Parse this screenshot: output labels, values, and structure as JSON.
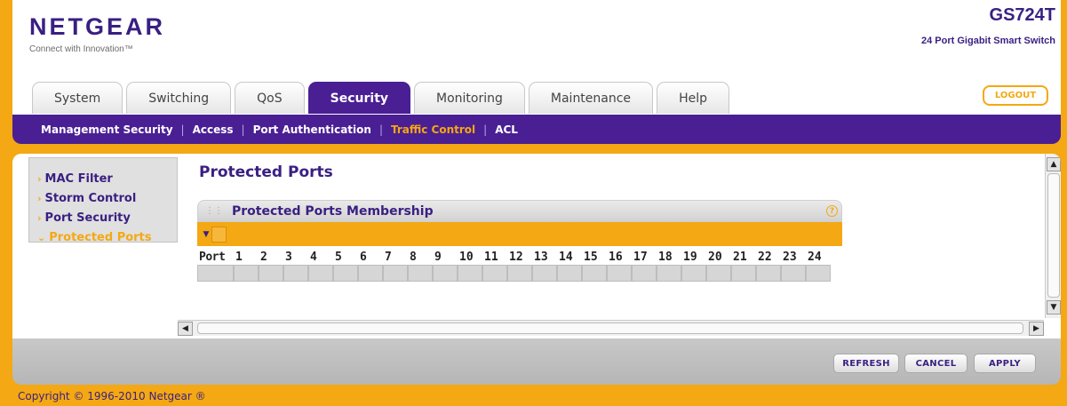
{
  "brand": {
    "name": "NETGEAR",
    "tagline": "Connect with Innovation™",
    "model": "GS724T",
    "model_desc": "24 Port Gigabit Smart Switch"
  },
  "tabs": [
    {
      "label": "System",
      "active": false
    },
    {
      "label": "Switching",
      "active": false
    },
    {
      "label": "QoS",
      "active": false
    },
    {
      "label": "Security",
      "active": true
    },
    {
      "label": "Monitoring",
      "active": false
    },
    {
      "label": "Maintenance",
      "active": false
    },
    {
      "label": "Help",
      "active": false
    }
  ],
  "logout_label": "LOGOUT",
  "subnav": [
    {
      "label": "Management Security",
      "active": false
    },
    {
      "label": "Access",
      "active": false
    },
    {
      "label": "Port Authentication",
      "active": false
    },
    {
      "label": "Traffic Control",
      "active": true
    },
    {
      "label": "ACL",
      "active": false
    }
  ],
  "leftnav": [
    {
      "label": "MAC Filter",
      "active": false
    },
    {
      "label": "Storm Control",
      "active": false
    },
    {
      "label": "Port Security",
      "active": false
    },
    {
      "label": "Protected Ports",
      "active": true
    }
  ],
  "page_title": "Protected Ports",
  "panel": {
    "title": "Protected Ports Membership",
    "help_icon": "?",
    "port_label": "Port",
    "ports": [
      "1",
      "2",
      "3",
      "4",
      "5",
      "6",
      "7",
      "8",
      "9",
      "10",
      "11",
      "12",
      "13",
      "14",
      "15",
      "16",
      "17",
      "18",
      "19",
      "20",
      "21",
      "22",
      "23",
      "24"
    ]
  },
  "buttons": {
    "refresh": "REFRESH",
    "cancel": "CANCEL",
    "apply": "APPLY"
  },
  "copyright": "Copyright © 1996-2010 Netgear ®",
  "colors": {
    "accent_orange": "#f4a813",
    "brand_purple": "#4a1f94",
    "text_purple": "#3a1f82"
  }
}
